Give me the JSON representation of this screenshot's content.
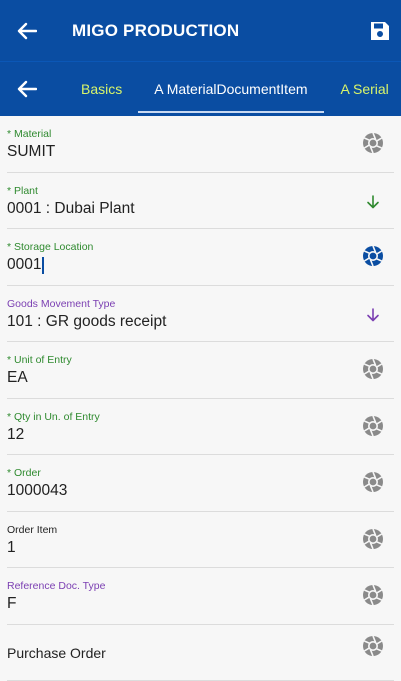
{
  "app": {
    "title": "MIGO PRODUCTION",
    "back_icon": "arrow-left-icon",
    "save_icon": "save-icon"
  },
  "tabs": {
    "back_icon": "arrow-left-icon",
    "items": [
      {
        "label": "Basics",
        "active": false
      },
      {
        "label": "A MaterialDocumentItem",
        "active": true
      },
      {
        "label": "A Serial",
        "active": false
      }
    ]
  },
  "fields": [
    {
      "label": "* Material",
      "value": "SUMIT",
      "icon": "aperture-icon"
    },
    {
      "label": "* Plant",
      "value": "0001 : Dubai Plant",
      "icon": "arrow-down-icon"
    },
    {
      "label": "* Storage Location",
      "value": "0001",
      "icon": "aperture-icon",
      "focused": true
    },
    {
      "label": "Goods Movement Type",
      "value": "101 : GR goods receipt",
      "icon": "arrow-down-icon"
    },
    {
      "label": "* Unit of Entry",
      "value": "EA",
      "icon": "aperture-icon"
    },
    {
      "label": "* Qty in Un. of Entry",
      "value": "12",
      "icon": "aperture-icon"
    },
    {
      "label": "* Order",
      "value": "1000043",
      "icon": "aperture-icon"
    },
    {
      "label": "Order Item",
      "value": "1",
      "icon": "aperture-icon"
    },
    {
      "label": "Reference Doc. Type",
      "value": "F",
      "icon": "aperture-icon"
    },
    {
      "label": "",
      "value": "Purchase Order",
      "icon": "aperture-icon"
    }
  ],
  "colors": {
    "header_bg": "#0a4da2",
    "tab_inactive": "#d9f56a",
    "required_label": "#2f8a2f",
    "optional_label_purple": "#7b3fb2",
    "icon_grey": "#8a8a8a",
    "icon_active": "#0a4da2"
  }
}
